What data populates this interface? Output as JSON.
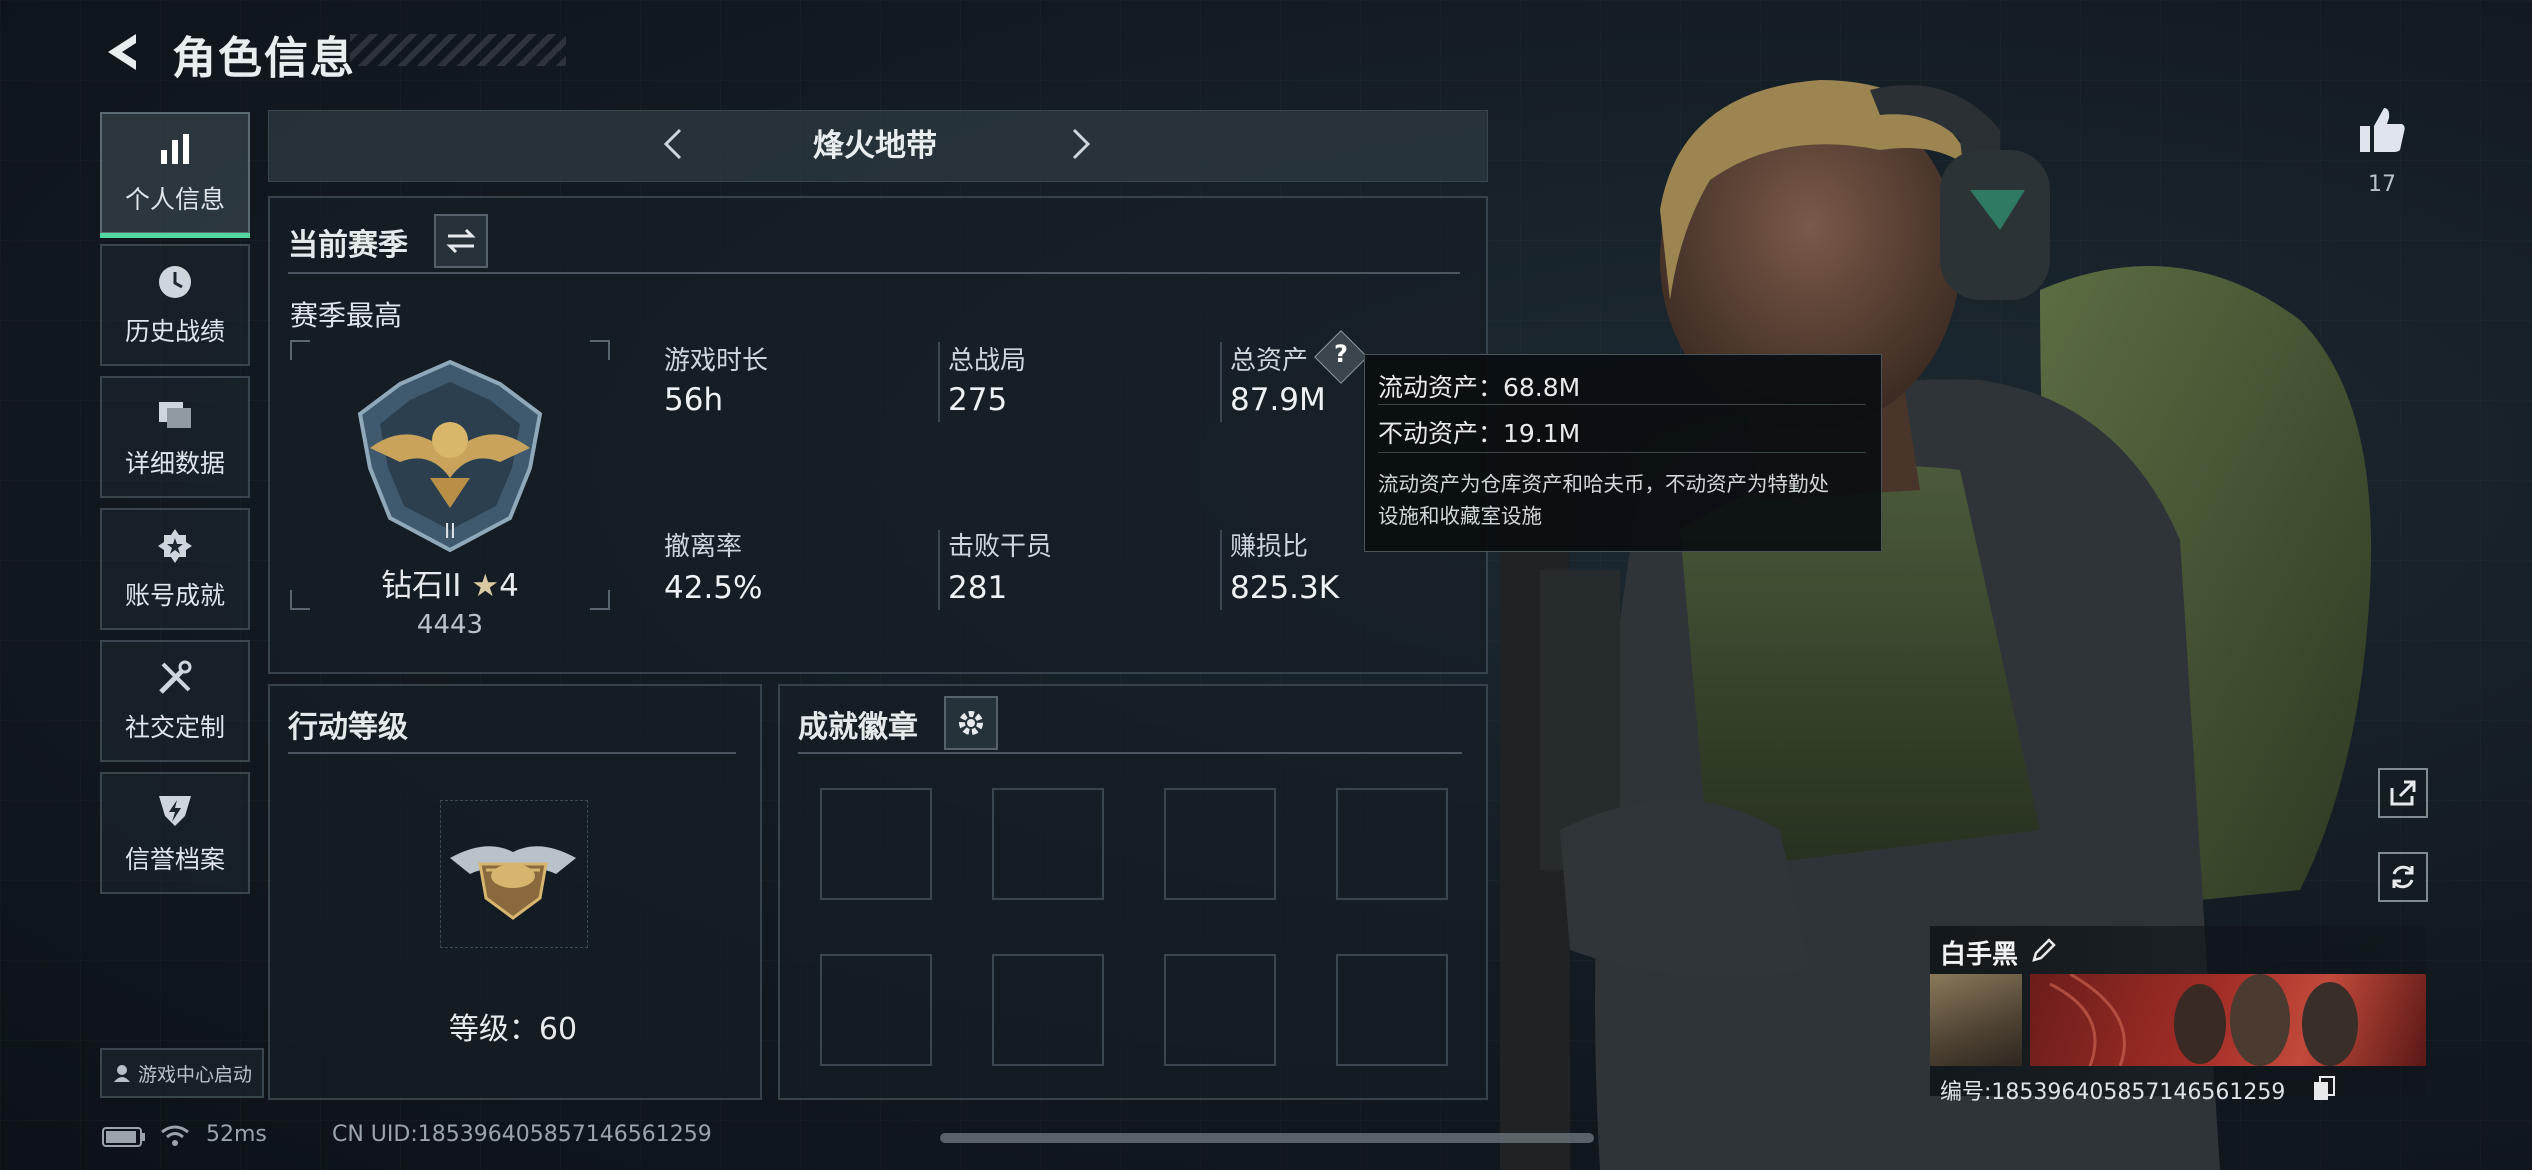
{
  "header": {
    "title": "角色信息"
  },
  "sidebar": {
    "items": [
      {
        "label": "个人信息",
        "icon": "bar-chart-icon",
        "active": true
      },
      {
        "label": "历史战绩",
        "icon": "clock-icon",
        "active": false
      },
      {
        "label": "详细数据",
        "icon": "folders-icon",
        "active": false
      },
      {
        "label": "账号成就",
        "icon": "medal-icon",
        "active": false
      },
      {
        "label": "社交定制",
        "icon": "tools-icon",
        "active": false
      },
      {
        "label": "信誉档案",
        "icon": "shield-badge-icon",
        "active": false
      }
    ],
    "game_center": "游戏中心启动"
  },
  "mode": {
    "title": "烽火地带"
  },
  "season": {
    "title": "当前赛季",
    "subtitle": "赛季最高",
    "rank": "钻石II",
    "stars": "4",
    "score": "4443",
    "stats": [
      {
        "label": "游戏时长",
        "value": "56h"
      },
      {
        "label": "总战局",
        "value": "275"
      },
      {
        "label": "总资产",
        "value": "87.9M"
      },
      {
        "label": "撤离率",
        "value": "42.5%"
      },
      {
        "label": "击败干员",
        "value": "281"
      },
      {
        "label": "赚损比",
        "value": "825.3K"
      }
    ]
  },
  "tooltip": {
    "liquid": "流动资产：68.8M",
    "fixed": "不动资产：19.1M",
    "note_line1": "流动资产为仓库资产和哈夫币，不动资产为特勤处",
    "note_line2": "设施和收藏室设施"
  },
  "action_level": {
    "title": "行动等级",
    "level_text": "等级：60"
  },
  "achievements": {
    "title": "成就徽章"
  },
  "profile": {
    "likes": "17",
    "name": "白手黑",
    "id_text": "编号:18539640585714656​1259"
  },
  "status_bar": {
    "ping": "52ms",
    "uid": "CN UID:18539640585714656​1259"
  },
  "colors": {
    "accent": "#54d6a0",
    "tooltip_bg": "#0a0e11",
    "panel_border": "#37434c"
  }
}
